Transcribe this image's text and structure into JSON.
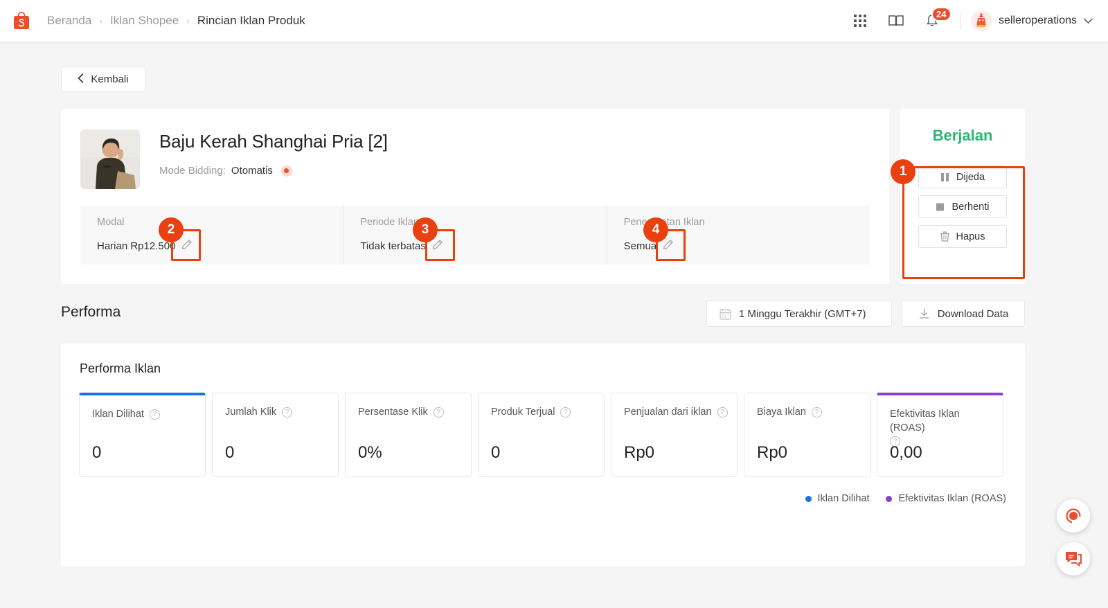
{
  "header": {
    "logo_icon": "shopee-bag-logo",
    "breadcrumb": [
      {
        "label": "Beranda",
        "active": false
      },
      {
        "label": "Iklan Shopee",
        "active": false
      },
      {
        "label": "Rincian Iklan Produk",
        "active": true
      }
    ],
    "separator": "›",
    "icons": [
      {
        "name": "apps-grid-icon"
      },
      {
        "name": "book-icon"
      },
      {
        "name": "bell-icon",
        "badge": "24"
      }
    ],
    "username": "selleroperations",
    "chevron": "⌄"
  },
  "back_button": {
    "label": "Kembali",
    "chevron": "‹"
  },
  "product": {
    "title": "Baju Kerah Shanghai Pria [2]",
    "bidding_label": "Mode Bidding:",
    "bidding_value": "Otomatis",
    "stats": [
      {
        "label": "Modal",
        "value": "Harian Rp12.500",
        "edit_icon": "pencil-icon"
      },
      {
        "label": "Periode Iklan",
        "value": "Tidak terbatas",
        "edit_icon": "pencil-icon"
      },
      {
        "label": "Penempatan Iklan",
        "value": "Semua",
        "edit_icon": "pencil-icon"
      }
    ]
  },
  "status_panel": {
    "status": "Berjalan",
    "status_color": "#2bb673",
    "actions": [
      {
        "label": "Dijeda",
        "icon": "pause-icon"
      },
      {
        "label": "Berhenti",
        "icon": "stop-icon"
      },
      {
        "label": "Hapus",
        "icon": "trash-icon"
      }
    ]
  },
  "performance": {
    "title": "Performa",
    "date_filter": "1 Minggu Terakhir (GMT+7)",
    "date_icon": "calendar-icon",
    "download_label": "Download Data",
    "download_icon": "download-icon",
    "chart_title": "Performa Iklan"
  },
  "chart_data": {
    "type": "line",
    "title": "Performa Iklan",
    "x": [],
    "series": [
      {
        "name": "Iklan Dilihat",
        "color": "#1a73e8",
        "values": []
      },
      {
        "name": "Efektivitas Iklan (ROAS)",
        "color": "#8a3fd1",
        "values": []
      }
    ],
    "legend_position": "bottom-right",
    "grid": false,
    "metrics": [
      {
        "label": "Iklan Dilihat",
        "value": "0",
        "selected": true,
        "accent": "#1a73e8",
        "help": "?"
      },
      {
        "label": "Jumlah Klik",
        "value": "0",
        "selected": false,
        "accent": "",
        "help": "?"
      },
      {
        "label": "Persentase Klik",
        "value": "0%",
        "selected": false,
        "accent": "",
        "help": "?"
      },
      {
        "label": "Produk Terjual",
        "value": "0",
        "selected": false,
        "accent": "",
        "help": "?"
      },
      {
        "label": "Penjualan dari iklan",
        "value": "Rp0",
        "selected": false,
        "accent": "",
        "help": "?"
      },
      {
        "label": "Biaya Iklan",
        "value": "Rp0",
        "selected": false,
        "accent": "",
        "help": "?"
      },
      {
        "label": "Efektivitas Iklan (ROAS)",
        "value": "0,00",
        "selected": true,
        "accent": "#8a3fd1",
        "help": "?"
      }
    ]
  },
  "legend": [
    {
      "label": "Iklan Dilihat",
      "color": "#1a73e8"
    },
    {
      "label": "Efektivitas Iklan (ROAS)",
      "color": "#8a3fd1"
    }
  ],
  "floating_buttons": [
    {
      "name": "support-fab",
      "icon": "headset-icon"
    },
    {
      "name": "chat-fab",
      "icon": "chat-icon"
    }
  ],
  "annotations": [
    {
      "number": "1",
      "target": "status-action-buttons"
    },
    {
      "number": "2",
      "target": "modal-edit-pencil"
    },
    {
      "number": "3",
      "target": "periode-edit-pencil"
    },
    {
      "number": "4",
      "target": "penempatan-edit-pencil"
    }
  ],
  "colors": {
    "brand": "#ee4d2d",
    "annotation": "#e8400f",
    "running": "#2bb673"
  }
}
